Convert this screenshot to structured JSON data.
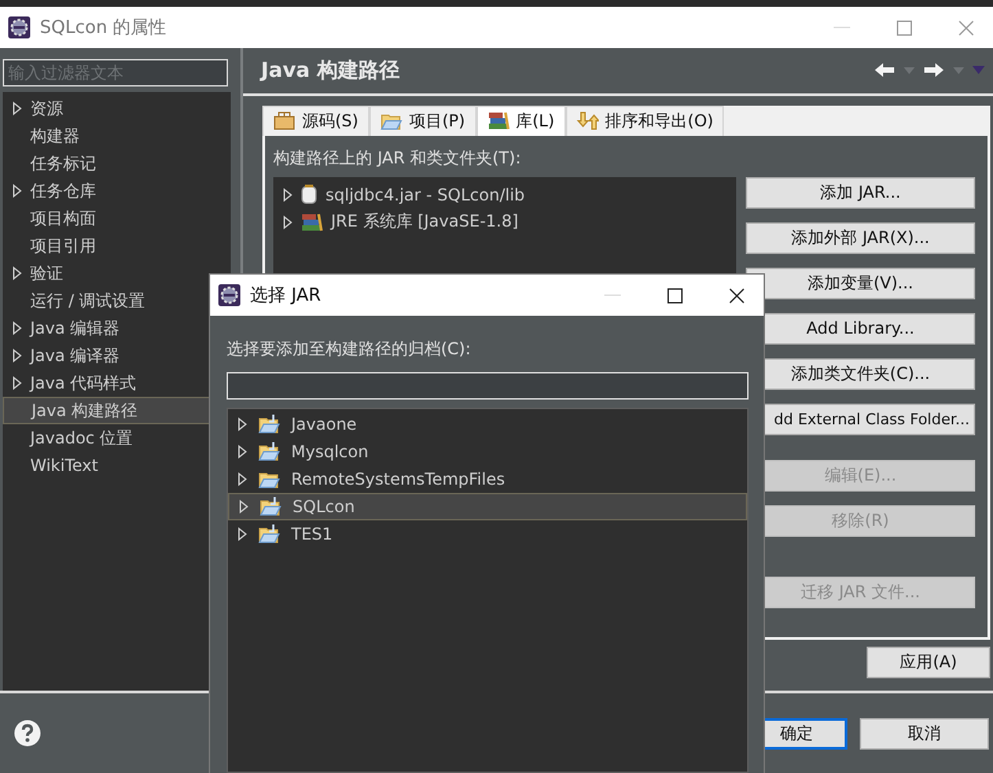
{
  "window": {
    "title": "SQLcon 的属性"
  },
  "filter": {
    "placeholder": "输入过滤器文本"
  },
  "sidebar": {
    "items": [
      {
        "label": "资源",
        "expandable": true,
        "selected": false
      },
      {
        "label": "构建器",
        "expandable": false,
        "selected": false
      },
      {
        "label": "任务标记",
        "expandable": false,
        "selected": false
      },
      {
        "label": "任务仓库",
        "expandable": true,
        "selected": false
      },
      {
        "label": "项目构面",
        "expandable": false,
        "selected": false
      },
      {
        "label": "项目引用",
        "expandable": false,
        "selected": false
      },
      {
        "label": "验证",
        "expandable": true,
        "selected": false
      },
      {
        "label": "运行 / 调试设置",
        "expandable": false,
        "selected": false
      },
      {
        "label": "Java 编辑器",
        "expandable": true,
        "selected": false
      },
      {
        "label": "Java 编译器",
        "expandable": true,
        "selected": false
      },
      {
        "label": "Java 代码样式",
        "expandable": true,
        "selected": false
      },
      {
        "label": "Java 构建路径",
        "expandable": false,
        "selected": true
      },
      {
        "label": "Javadoc 位置",
        "expandable": false,
        "selected": false
      },
      {
        "label": "WikiText",
        "expandable": false,
        "selected": false
      }
    ]
  },
  "page": {
    "title": "Java 构建路径",
    "tabs": [
      {
        "label": "源码(S)",
        "kind": "source",
        "selected": false
      },
      {
        "label": "项目(P)",
        "kind": "project",
        "selected": false
      },
      {
        "label": "库(L)",
        "kind": "library",
        "selected": true
      },
      {
        "label": "排序和导出(O)",
        "kind": "order",
        "selected": false
      }
    ],
    "list_label": "构建路径上的 JAR 和类文件夹(T):",
    "entries": [
      {
        "label": "sqljdbc4.jar - SQLcon/lib",
        "kind": "jar"
      },
      {
        "label": "JRE 系统库 [JavaSE-1.8]",
        "kind": "library"
      }
    ],
    "buttons": [
      {
        "label": "添加 JAR...",
        "disabled": false
      },
      {
        "label": "添加外部 JAR(X)...",
        "disabled": false
      },
      {
        "label": "添加变量(V)...",
        "disabled": false
      },
      {
        "label": "Add Library...",
        "disabled": false
      },
      {
        "label": "添加类文件夹(C)...",
        "disabled": false
      },
      {
        "label": "dd External Class Folder...",
        "disabled": false
      },
      {
        "label": "编辑(E)...",
        "disabled": true
      },
      {
        "label": "移除(R)",
        "disabled": true
      },
      {
        "label": "迁移 JAR 文件...",
        "disabled": true
      }
    ],
    "apply": "应用(A)"
  },
  "footer": {
    "buttons": [
      {
        "label": "确定",
        "default": true
      },
      {
        "label": "取消",
        "default": false
      }
    ]
  },
  "dialog": {
    "title": "选择 JAR",
    "label": "选择要添加至构建路径的归档(C):",
    "items": [
      {
        "label": "Javaone",
        "kind": "project",
        "selected": false
      },
      {
        "label": "Mysqlcon",
        "kind": "project",
        "selected": false
      },
      {
        "label": "RemoteSystemsTempFiles",
        "kind": "folder",
        "selected": false
      },
      {
        "label": "SQLcon",
        "kind": "project",
        "selected": true
      },
      {
        "label": "TES1",
        "kind": "project",
        "selected": false
      }
    ]
  }
}
